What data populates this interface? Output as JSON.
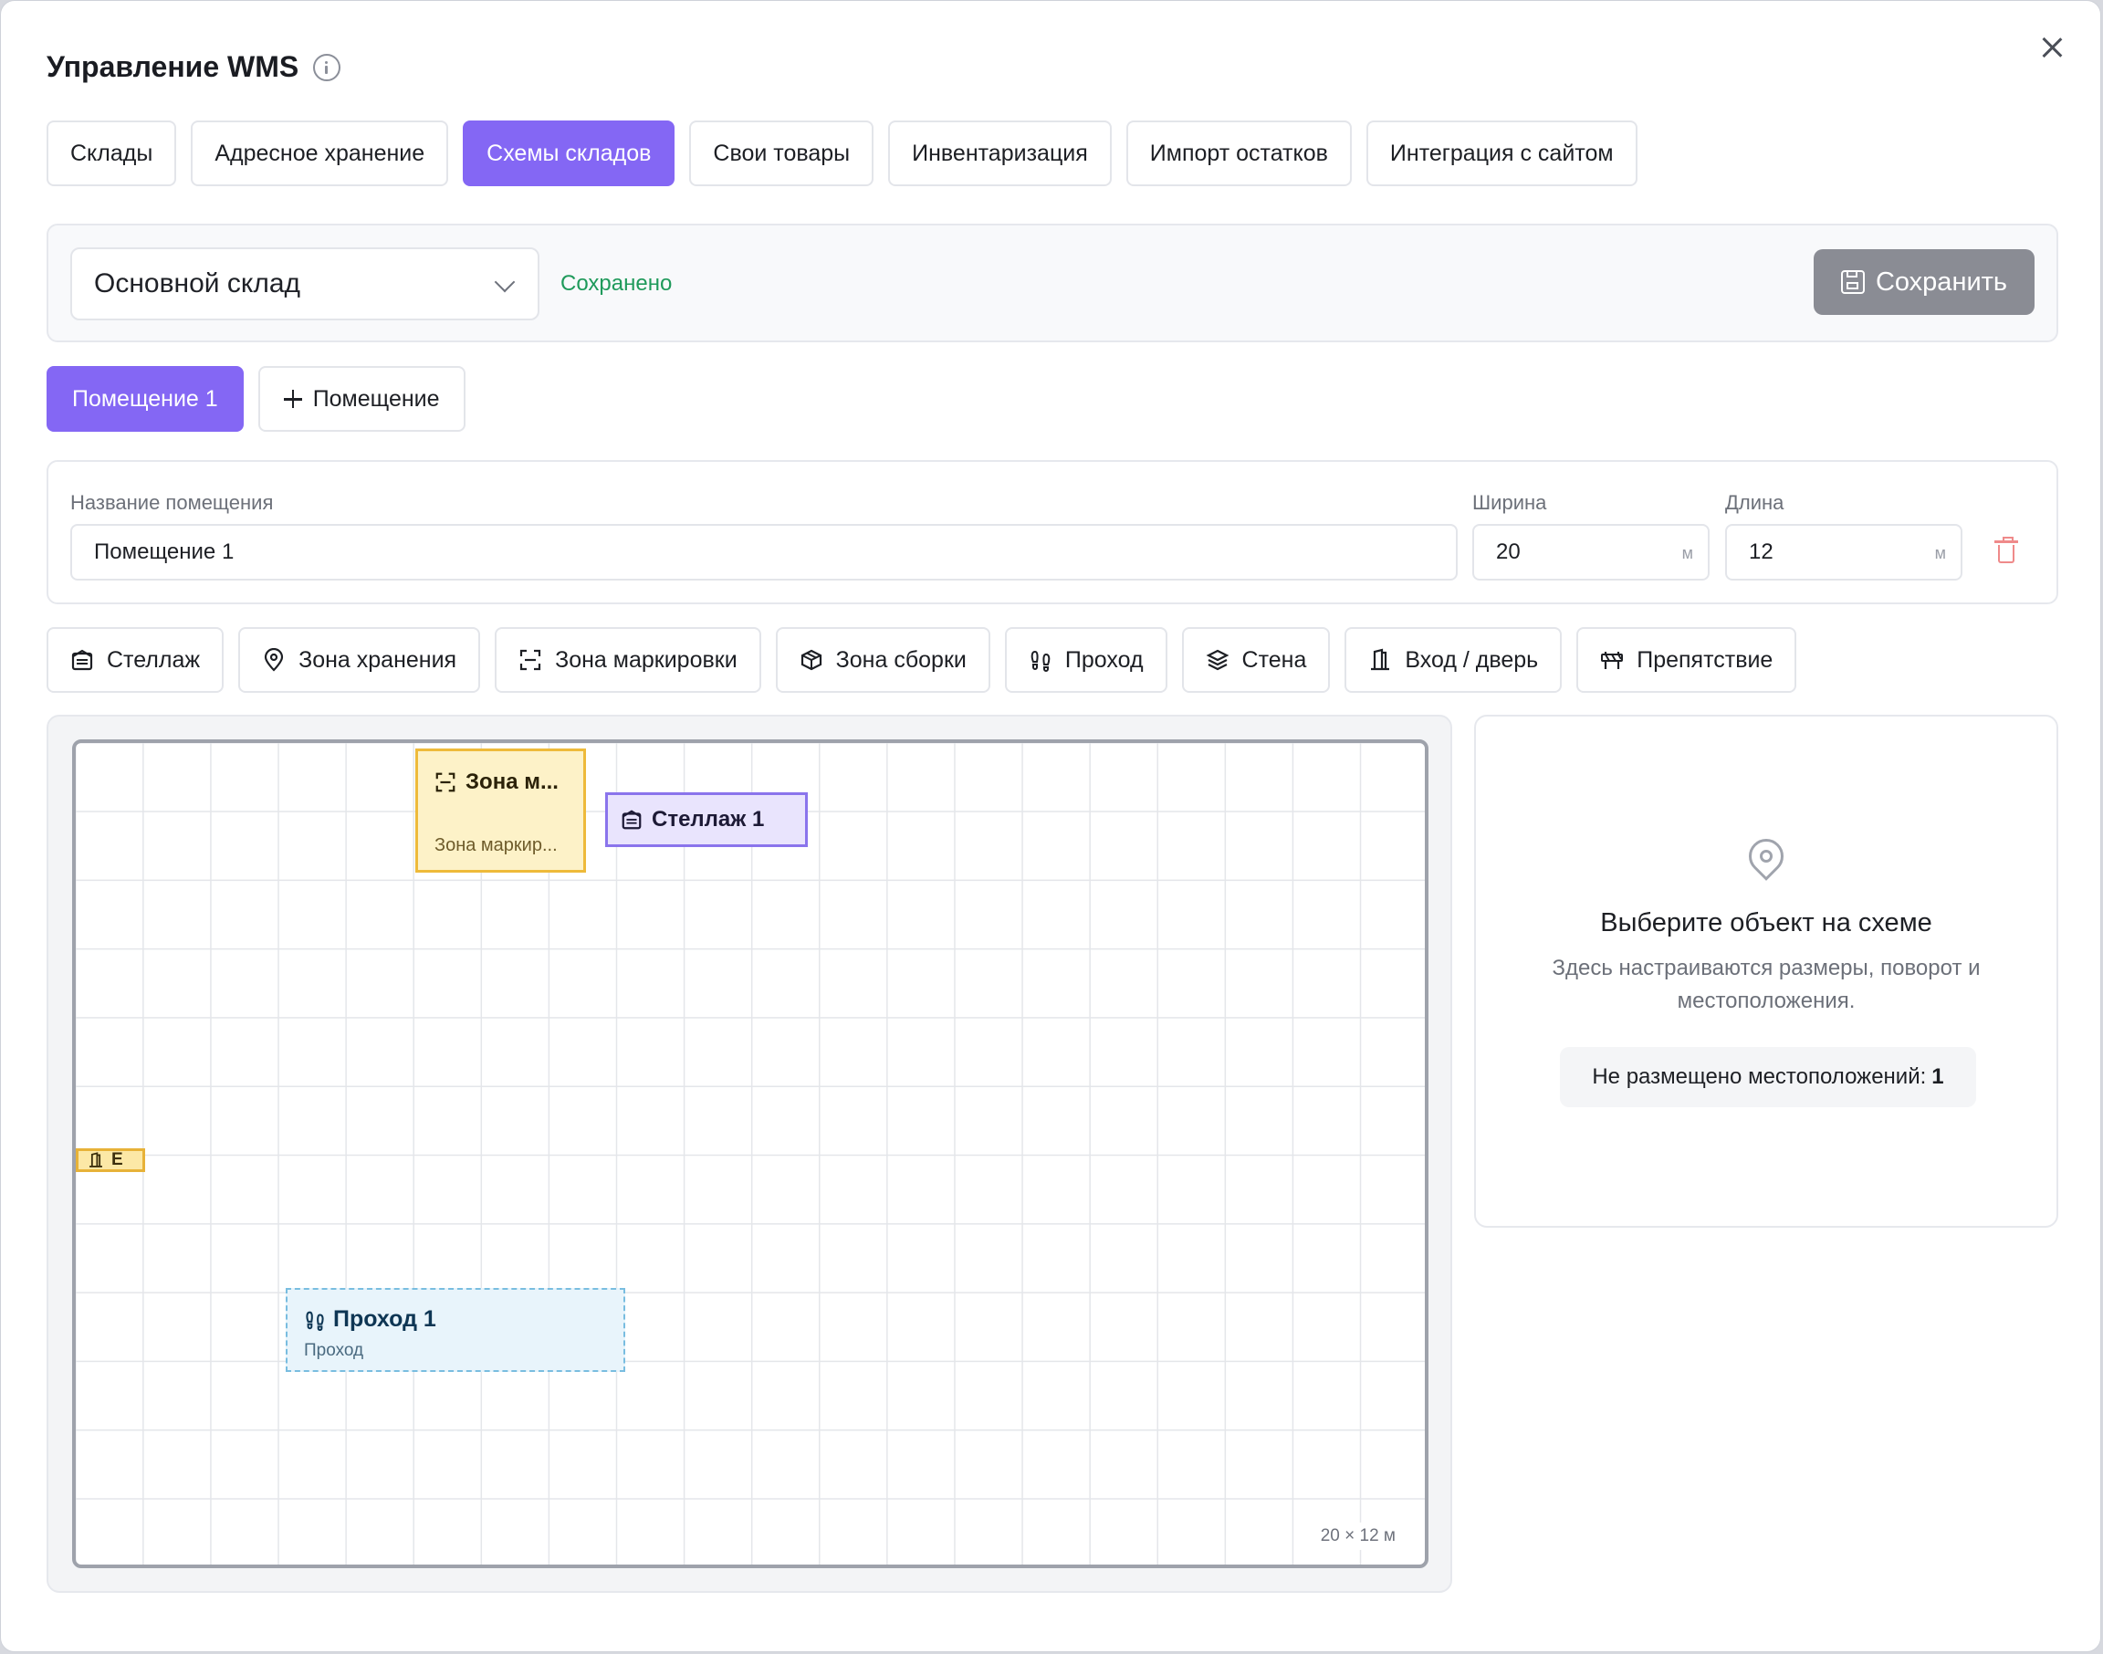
{
  "header": {
    "title": "Управление WMS"
  },
  "tabs": [
    {
      "label": "Склады"
    },
    {
      "label": "Адресное хранение"
    },
    {
      "label": "Схемы складов",
      "active": true
    },
    {
      "label": "Свои товары"
    },
    {
      "label": "Инвентаризация"
    },
    {
      "label": "Импорт остатков"
    },
    {
      "label": "Интеграция с сайтом"
    }
  ],
  "warehouse": {
    "selected": "Основной склад",
    "status": "Сохранено",
    "save_label": "Сохранить"
  },
  "rooms": {
    "active": "Помещение 1",
    "add_label": "Помещение"
  },
  "room_form": {
    "name_label": "Название помещения",
    "name_value": "Помещение 1",
    "width_label": "Ширина",
    "width_value": "20",
    "length_label": "Длина",
    "length_value": "12",
    "unit": "м"
  },
  "tools": [
    {
      "label": "Стеллаж",
      "icon": "rack-icon"
    },
    {
      "label": "Зона хранения",
      "icon": "map-pin-icon"
    },
    {
      "label": "Зона маркировки",
      "icon": "scan-icon"
    },
    {
      "label": "Зона сборки",
      "icon": "package-icon"
    },
    {
      "label": "Проход",
      "icon": "footprints-icon"
    },
    {
      "label": "Стена",
      "icon": "layers-icon"
    },
    {
      "label": "Вход / дверь",
      "icon": "door-icon"
    },
    {
      "label": "Препятствие",
      "icon": "barrier-icon"
    }
  ],
  "canvas": {
    "zone_mark": {
      "title": "Зона м...",
      "subtitle": "Зона маркир..."
    },
    "rack": {
      "title": "Стеллаж 1"
    },
    "door": {
      "title": "E"
    },
    "pass": {
      "title": "Проход 1",
      "subtitle": "Проход"
    },
    "dimensions": "20 × 12 м"
  },
  "side_panel": {
    "title": "Выберите объект на схеме",
    "description": "Здесь настраиваются размеры, поворот и местоположения.",
    "badge_label": "Не размещено местоположений:",
    "badge_count": "1"
  },
  "colors": {
    "accent": "#8467f4",
    "saved": "#1f9a5b",
    "zone_mark_fill": "#fdf2c8",
    "rack_fill": "#e9e4fd",
    "pass_fill": "#e8f4fb",
    "delete": "#ef8a8a"
  }
}
